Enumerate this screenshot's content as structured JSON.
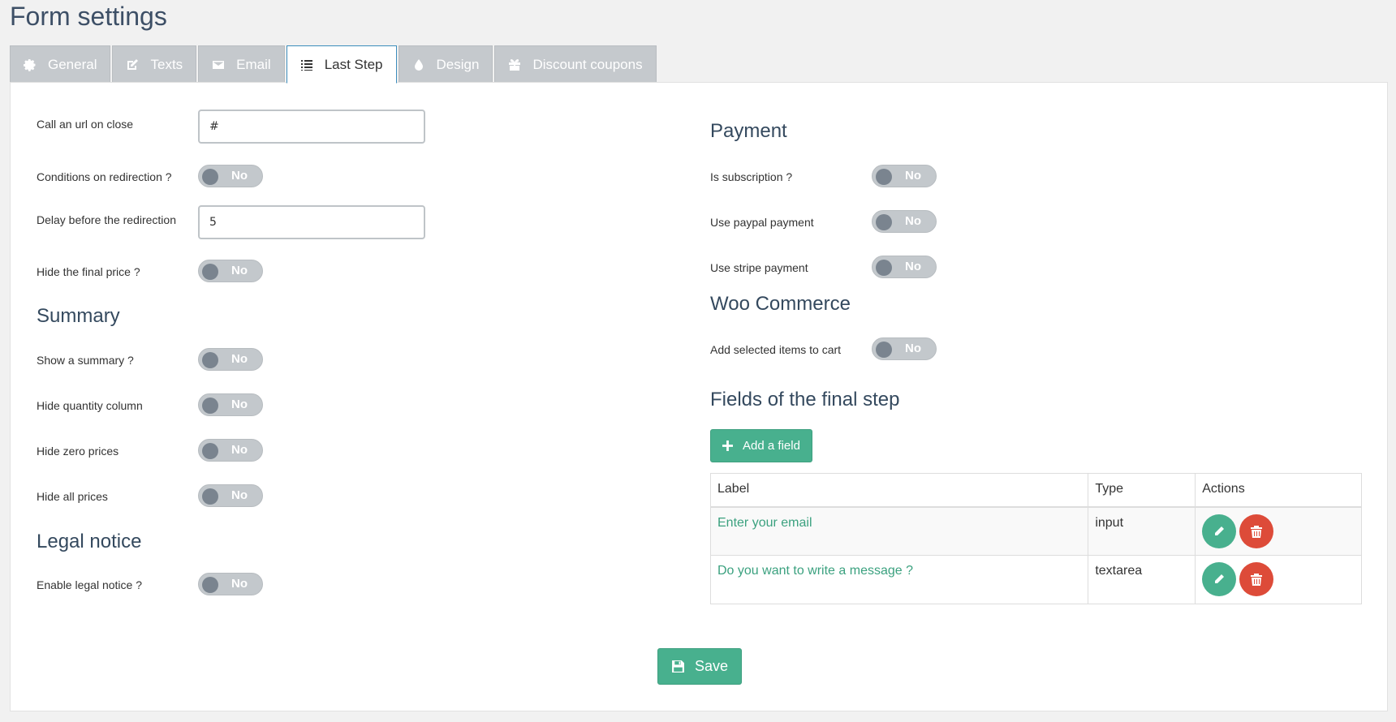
{
  "page_title": "Form settings",
  "tabs": [
    {
      "label": "General",
      "icon": "gear-icon"
    },
    {
      "label": "Texts",
      "icon": "edit-icon"
    },
    {
      "label": "Email",
      "icon": "envelope-icon"
    },
    {
      "label": "Last Step",
      "icon": "list-icon",
      "active": true
    },
    {
      "label": "Design",
      "icon": "drop-icon"
    },
    {
      "label": "Discount coupons",
      "icon": "gift-icon"
    }
  ],
  "left": {
    "call_url_label": "Call an url on close",
    "call_url_value": "#",
    "conditions_label": "Conditions on redirection ?",
    "delay_label": "Delay before the redirection",
    "delay_value": "5",
    "hide_final_price_label": "Hide the final price ?",
    "summary_title": "Summary",
    "show_summary_label": "Show a summary ?",
    "hide_quantity_label": "Hide quantity column",
    "hide_zero_label": "Hide zero prices",
    "hide_all_label": "Hide all prices",
    "legal_title": "Legal notice",
    "enable_legal_label": "Enable legal notice ?"
  },
  "right": {
    "payment_title": "Payment",
    "subscription_label": "Is subscription ?",
    "paypal_label": "Use paypal payment",
    "stripe_label": "Use stripe payment",
    "woo_title": "Woo Commerce",
    "add_cart_label": "Add selected items to cart",
    "fields_title": "Fields of the final step",
    "add_field_label": "Add a field"
  },
  "toggle_off_text": "No",
  "table": {
    "headers": [
      "Label",
      "Type",
      "Actions"
    ],
    "rows": [
      {
        "label": "Enter your email",
        "type": "input"
      },
      {
        "label": "Do you want to write a message ?",
        "type": "textarea"
      }
    ]
  },
  "save_label": "Save",
  "colors": {
    "accent": "#48b08e",
    "danger": "#dd4b39",
    "tab_active_border": "#3c8dbc"
  }
}
